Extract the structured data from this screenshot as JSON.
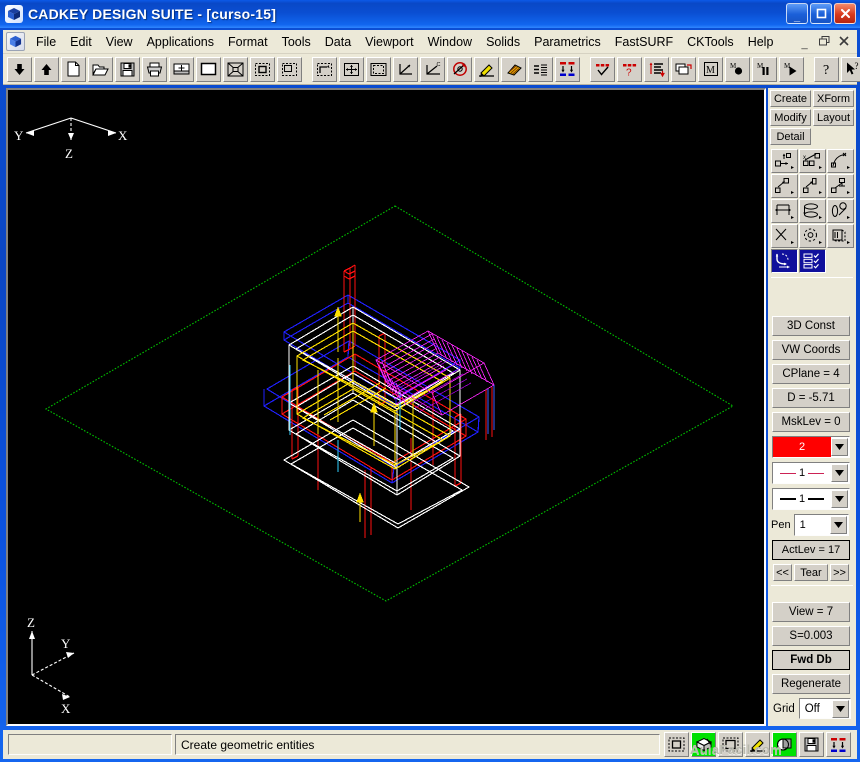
{
  "window": {
    "title": "CADKEY DESIGN SUITE - [curso-15]",
    "app_icon": "cadkey-cube-icon",
    "minimize_label": "_",
    "maximize_label": "❐",
    "close_label": "✕"
  },
  "menubar": {
    "app_icon": "document-cube-icon",
    "items": [
      "File",
      "Edit",
      "View",
      "Applications",
      "Format",
      "Tools",
      "Data",
      "Viewport",
      "Window",
      "Solids",
      "Parametrics",
      "FastSURF",
      "CKTools",
      "Help"
    ],
    "sys_buttons": [
      "_",
      "❐",
      "✕"
    ]
  },
  "toolbar": {
    "buttons": [
      {
        "name": "arrow-down-icon",
        "title": "Down"
      },
      {
        "name": "arrow-up-icon",
        "title": "Up"
      },
      {
        "name": "new-file-icon",
        "title": "New"
      },
      {
        "name": "open-folder-icon",
        "title": "Open"
      },
      {
        "name": "save-disk-icon",
        "title": "Save"
      },
      {
        "name": "printer-icon",
        "title": "Print"
      },
      {
        "name": "plot-window-icon",
        "title": "Plot"
      },
      {
        "name": "blank-window-icon",
        "title": "Redraw"
      },
      {
        "name": "zoom-fit-icon",
        "title": "Autoscale"
      },
      {
        "name": "zoom-box-icon",
        "title": "Zoom Window"
      },
      {
        "name": "zoom-selection-icon",
        "title": "Zoom Selection"
      },
      {
        "name": "zoom-back-icon",
        "title": "Zoom Back"
      },
      {
        "name": "zoom-all-icon",
        "title": "Zoom All"
      },
      {
        "name": "axes-icon",
        "title": "View Axes"
      },
      {
        "name": "axes-cplane-icon",
        "title": "Construction Plane"
      },
      {
        "name": "rotate-view-icon",
        "title": "Rotate View"
      },
      {
        "name": "pencil-icon",
        "title": "Draw"
      },
      {
        "name": "hatch-icon",
        "title": "Hatch"
      },
      {
        "name": "levels-icon",
        "title": "Levels"
      },
      {
        "name": "verify-down-icon",
        "title": "Verify"
      },
      {
        "name": "check-mask-icon",
        "title": "Mask On"
      },
      {
        "name": "query-mask-icon",
        "title": "Mask Off"
      },
      {
        "name": "sort-list-icon",
        "title": "Sort"
      },
      {
        "name": "copy-layers-icon",
        "title": "Copy"
      },
      {
        "name": "macro-icon",
        "title": "Macro"
      },
      {
        "name": "macro-record-icon",
        "title": "Record Macro"
      },
      {
        "name": "macro-pause-icon",
        "title": "Pause Macro"
      },
      {
        "name": "macro-play-icon",
        "title": "Play Macro"
      },
      {
        "name": "help-icon",
        "title": "Help"
      },
      {
        "name": "help-pointer-icon",
        "title": "Context Help"
      }
    ]
  },
  "viewport": {
    "background_color": "#000000",
    "axis_top_right": {
      "x_label": "X",
      "y_label": "Y",
      "z_label": "Z"
    },
    "axis_bottom_left": {
      "x_label": "X",
      "y_label": "Y",
      "z_label": "Z"
    },
    "grid_plane_color": "#00c000",
    "model_colors": [
      "#ff0000",
      "#0000ff",
      "#ffffff",
      "#ffff00",
      "#ff00ff",
      "#00ffff"
    ]
  },
  "right_panel": {
    "mode_buttons": [
      {
        "label": "Create",
        "active": false
      },
      {
        "label": "XForm",
        "active": false
      },
      {
        "label": "Modify",
        "active": false
      },
      {
        "label": "Layout",
        "active": false
      },
      {
        "label": "Detail",
        "active": false
      }
    ],
    "icon_grid": [
      [
        {
          "name": "point-position-icon",
          "selected": false
        },
        {
          "name": "point-divide-icon",
          "selected": false
        },
        {
          "name": "line-sketch-icon",
          "selected": false
        }
      ],
      [
        {
          "name": "line-parallel-icon",
          "selected": false
        },
        {
          "name": "line-rectangle-icon",
          "selected": false
        },
        {
          "name": "line-polygon-icon",
          "selected": false
        }
      ],
      [
        {
          "name": "spline-icon",
          "selected": false
        },
        {
          "name": "ellipse-fit-icon",
          "selected": false
        },
        {
          "name": "circle-arc-icon",
          "selected": false
        }
      ],
      [
        {
          "name": "conic-icon",
          "selected": false
        },
        {
          "name": "arc-pattern-icon",
          "selected": false
        },
        {
          "name": "surface-icon",
          "selected": false
        }
      ],
      [
        {
          "name": "fillet-icon",
          "selected": true
        },
        {
          "name": "list-check-icon",
          "selected": true
        }
      ]
    ],
    "status_buttons": [
      {
        "label": "3D Const",
        "bold": false
      },
      {
        "label": "VW Coords",
        "bold": false
      },
      {
        "label": "CPlane =  4",
        "bold": false
      },
      {
        "label": "D = -5.71",
        "bold": false
      },
      {
        "label": "MskLev = 0",
        "bold": false
      }
    ],
    "color_combo": {
      "name": "color-combo",
      "value": "2",
      "color": "#ff0000",
      "text_color": "#ffffff"
    },
    "linetype_combo": {
      "name": "linetype-combo",
      "value": "1",
      "line_color": "#cc2255"
    },
    "linewidth_combo": {
      "name": "linewidth-combo",
      "value": "1",
      "line_color": "#000000"
    },
    "pen": {
      "label": "Pen",
      "value": "1"
    },
    "act_lev": {
      "label": "ActLev = 17"
    },
    "nav": {
      "prev": "<<",
      "tear": "Tear",
      "next": ">>"
    },
    "bottom_buttons": [
      {
        "label": "View = 7",
        "bold": false
      },
      {
        "label": "S=0.003",
        "bold": false
      },
      {
        "label": "Fwd Db",
        "bold": true
      },
      {
        "label": "Regenerate",
        "bold": false
      }
    ],
    "grid": {
      "label": "Grid",
      "value": "Off"
    }
  },
  "statusbar": {
    "coordinate_field": "",
    "message": "Create geometric entities",
    "buttons": [
      {
        "name": "select-window-icon",
        "active": false
      },
      {
        "name": "shade-model-icon",
        "active": true
      },
      {
        "name": "select-box-icon",
        "active": false
      },
      {
        "name": "pencil-draw-icon",
        "active": false
      },
      {
        "name": "solids-overlap-icon",
        "active": true
      },
      {
        "name": "save-disk-icon",
        "active": false
      },
      {
        "name": "verify-down-icon",
        "active": false
      }
    ]
  },
  "watermark": {
    "text": "AulaFacil.com"
  }
}
